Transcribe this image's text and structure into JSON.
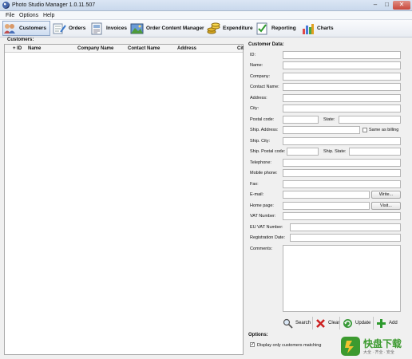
{
  "window": {
    "title": "Photo Studio Manager 1.0.11.507",
    "minimize": "–",
    "maximize": "□",
    "close": "✕"
  },
  "menu": [
    "File",
    "Options",
    "Help"
  ],
  "toolbar": [
    {
      "label": "Customers",
      "icon": "customers-icon",
      "active": true
    },
    {
      "label": "Orders",
      "icon": "orders-icon",
      "active": false
    },
    {
      "label": "Invoices",
      "icon": "invoices-icon",
      "active": false
    },
    {
      "label": "Order Content Manager",
      "icon": "order-content-manager-icon",
      "active": false
    },
    {
      "label": "Expenditure",
      "icon": "expenditure-icon",
      "active": false
    },
    {
      "label": "Reporting",
      "icon": "reporting-icon",
      "active": false
    },
    {
      "label": "Charts",
      "icon": "charts-icon",
      "active": false
    }
  ],
  "customers": {
    "label": "Customers:",
    "columns": [
      "+ ID",
      "Name",
      "Company Name",
      "Contact Name",
      "Address",
      "Cit"
    ],
    "rows": []
  },
  "customer_data": {
    "label": "Customer Data:",
    "fields": {
      "id": "ID:",
      "name": "Name:",
      "company": "Company:",
      "contact_name": "Contact Name:",
      "address": "Address:",
      "city": "City:",
      "postal_code": "Postal code:",
      "state": "State:",
      "ship_address": "Ship. Address:",
      "same_as_billing": "Same as billing",
      "ship_city": "Ship. City:",
      "ship_postal_code": "Ship. Postal code:",
      "ship_state": "Ship. State:",
      "telephone": "Telephone:",
      "mobile_phone": "Mobile phone:",
      "fax": "Fax:",
      "email": "E-mail:",
      "write_button": "Write...",
      "home_page": "Home page:",
      "visit_button": "Visit...",
      "vat_number": "VAT Number:",
      "eu_vat_number": "EU VAT Number:",
      "registration_date": "Registration Date:",
      "comments": "Comments:"
    },
    "values": {
      "id": "",
      "name": "",
      "company": "",
      "contact_name": "",
      "address": "",
      "city": "",
      "postal_code": "",
      "state": "",
      "ship_address": "",
      "ship_city": "",
      "ship_postal_code": "",
      "ship_state": "",
      "telephone": "",
      "mobile_phone": "",
      "fax": "",
      "email": "",
      "home_page": "",
      "vat_number": "",
      "eu_vat_number": "",
      "registration_date": "",
      "comments": ""
    },
    "same_as_billing_checked": false
  },
  "actions": [
    {
      "label": "Search",
      "icon": "search-icon"
    },
    {
      "label": "Clear",
      "icon": "clear-icon"
    },
    {
      "label": "Update",
      "icon": "update-icon"
    },
    {
      "label": "Add",
      "icon": "add-icon"
    }
  ],
  "options": {
    "label": "Options:",
    "display_only_matching": "Display only customers matching",
    "display_only_matching_checked": true
  },
  "watermark": {
    "main": "快盘下载",
    "sub": "大全 · 齐全 · 安全"
  },
  "colors": {
    "accent": "#3a78c8",
    "active_tab": "#cddcf0",
    "close": "#c8463a",
    "watermark": "#3c9a2f"
  }
}
